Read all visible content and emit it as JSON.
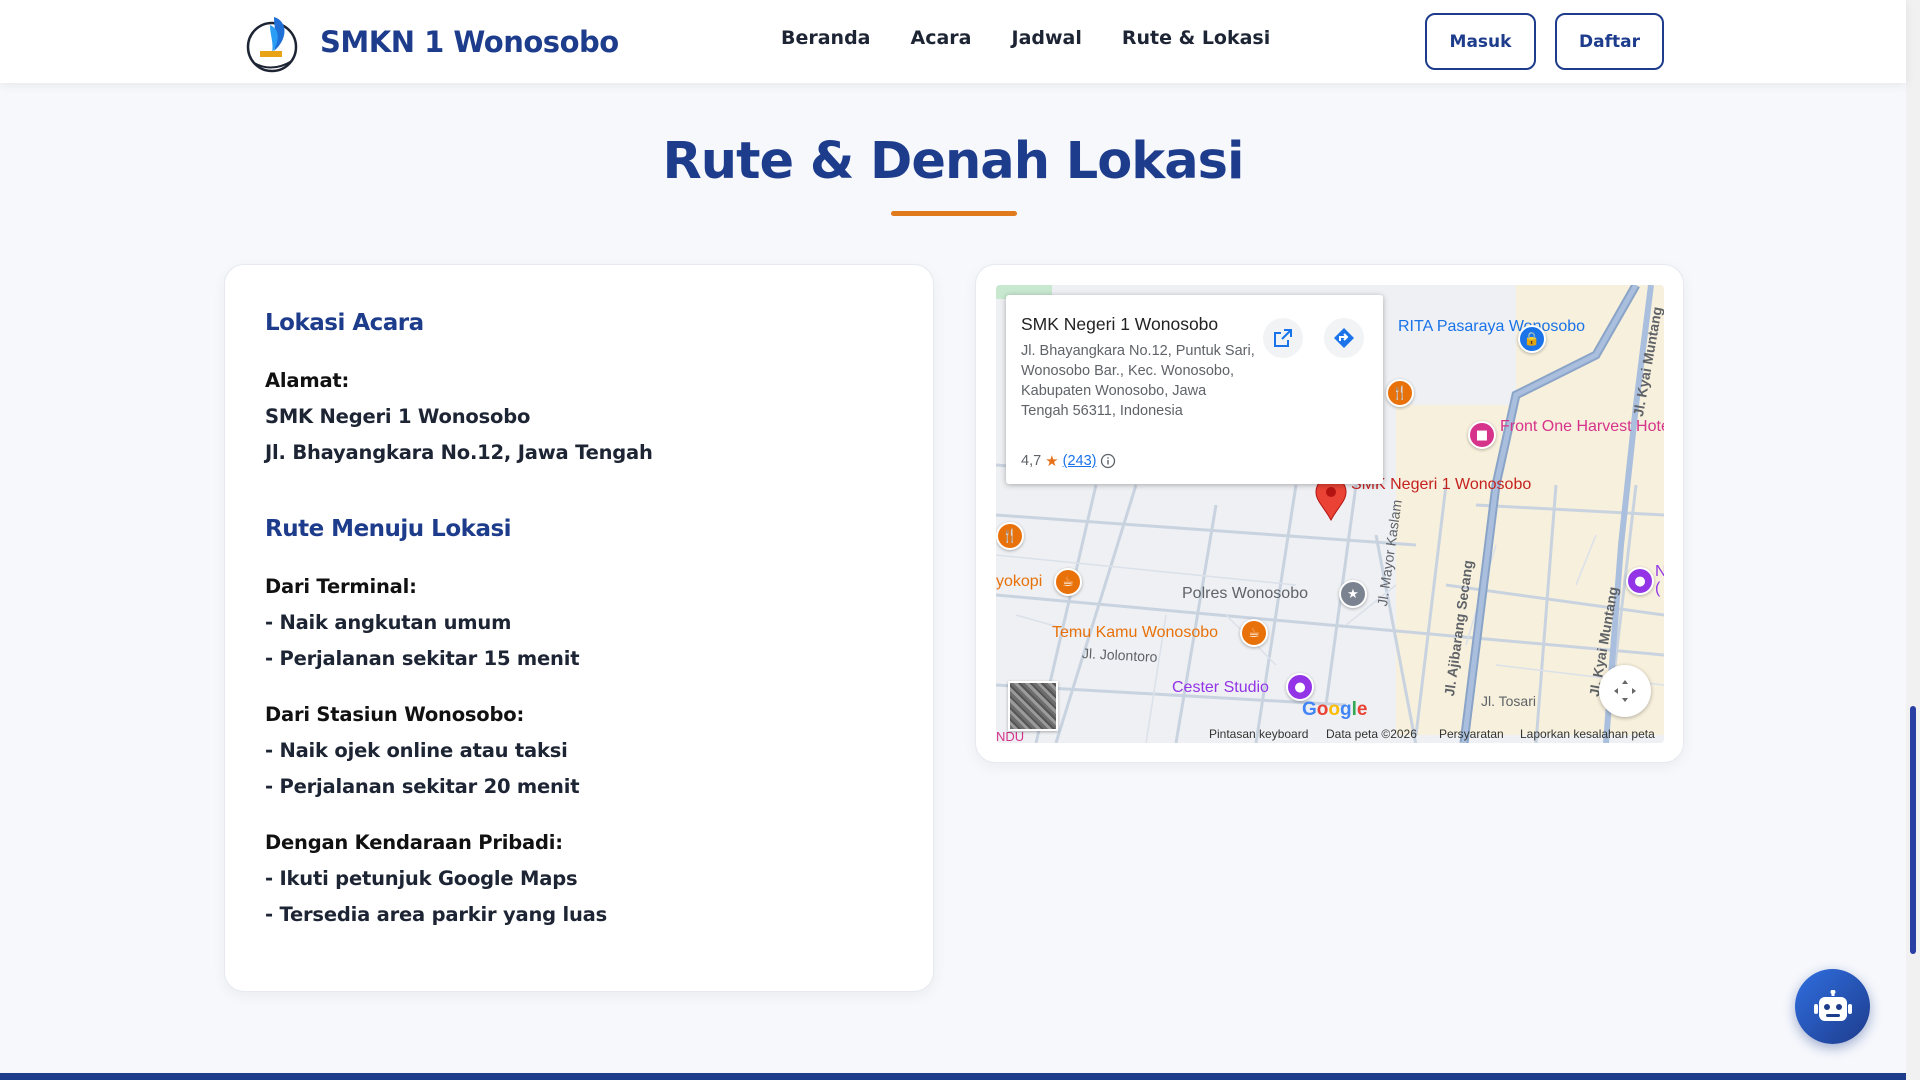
{
  "header": {
    "brand": "SMKN 1 Wonosobo",
    "nav": [
      "Beranda",
      "Acara",
      "Jadwal",
      "Rute & Lokasi"
    ],
    "login_label": "Masuk",
    "register_label": "Daftar"
  },
  "section": {
    "title": "Rute & Denah Lokasi"
  },
  "location": {
    "heading": "Lokasi Acara",
    "address_label": "Alamat:",
    "address_line1": "SMK Negeri 1 Wonosobo",
    "address_line2": "Jl. Bhayangkara No.12, Jawa Tengah"
  },
  "route": {
    "heading": "Rute Menuju Lokasi",
    "groups": [
      {
        "title": "Dari Terminal:",
        "items": [
          "- Naik angkutan umum",
          "- Perjalanan sekitar 15 menit"
        ]
      },
      {
        "title": "Dari Stasiun Wonosobo:",
        "items": [
          "- Naik ojek online atau taksi",
          "- Perjalanan sekitar 20 menit"
        ]
      },
      {
        "title": "Dengan Kendaraan Pribadi:",
        "items": [
          "- Ikuti petunjuk Google Maps",
          "- Tersedia area parkir yang luas"
        ]
      }
    ]
  },
  "map": {
    "place_name": "SMK Negeri 1 Wonosobo",
    "place_address": "Jl. Bhayangkara No.12, Puntuk Sari, Wonosobo Bar., Kec. Wonosobo, Kabupaten Wonosobo, Jawa Tengah 56311, Indonesia",
    "rating": "4,7",
    "reviews": "(243)",
    "labels": {
      "rita": "RITA Pasaraya Wonosobo",
      "hotel": "Front One Harvest Hotel Wonosobo",
      "school_pin": "SMK Negeri 1 Wonosobo",
      "polres": "Polres Wonosobo",
      "temu": "Temu Kamu Wonosobo",
      "kopi": "yokopi",
      "cester": "Cester Studio",
      "jolontoro": "Jl. Jolontoro",
      "mayor": "Jl. Mayor Kaslam",
      "ajibarang": "Jl. Ajibarang Secang",
      "kyai": "Jl. Kyai Muntang",
      "kyai2": "Jl. Kyai Muntang",
      "tosari": "Jl. Tosari",
      "edge_n": "N",
      "edge_paren": "(",
      "edge_ndu": "NDU",
      "google": "Google"
    },
    "attribution": {
      "shortcuts": "Pintasan keyboard",
      "data": "Data peta ©2026",
      "terms": "Persyaratan",
      "report": "Laporkan kesalahan peta"
    }
  },
  "colors": {
    "primary": "#1e3c8c",
    "accent": "#e07a1c",
    "background": "#f6f8fc"
  }
}
